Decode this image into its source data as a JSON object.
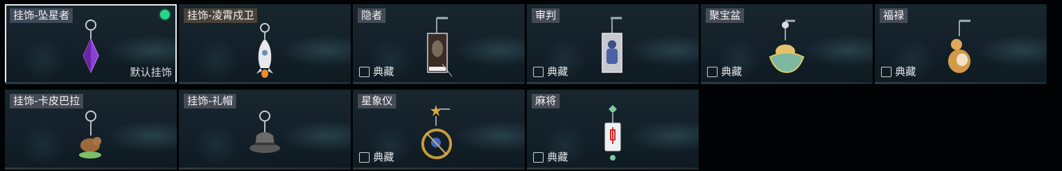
{
  "items": [
    {
      "name": "挂饰-坠星者",
      "label": "默认挂饰",
      "equipped": true
    },
    {
      "name": "挂饰-凌霄戍卫"
    },
    {
      "name": "隐者",
      "tag": "典藏"
    },
    {
      "name": "审判",
      "tag": "典藏"
    },
    {
      "name": "聚宝盆",
      "tag": "典藏"
    },
    {
      "name": "福禄",
      "tag": "典藏"
    },
    {
      "name": "挂饰-卡皮巴拉"
    },
    {
      "name": "挂饰-礼帽"
    },
    {
      "name": "星象仪",
      "tag": "典藏"
    },
    {
      "name": "麻将",
      "tag": "典藏"
    }
  ],
  "colors": {
    "selected_border": "#e9eef0",
    "equipped_dot": "#27d58a"
  },
  "icons": [
    "crystal-charm-icon",
    "rocket-charm-icon",
    "hermit-card-icon",
    "judgment-card-icon",
    "treasure-bowl-icon",
    "gourd-icon",
    "capybara-icon",
    "top-hat-icon",
    "astrolabe-icon",
    "mahjong-tile-icon",
    "collection-icon"
  ]
}
